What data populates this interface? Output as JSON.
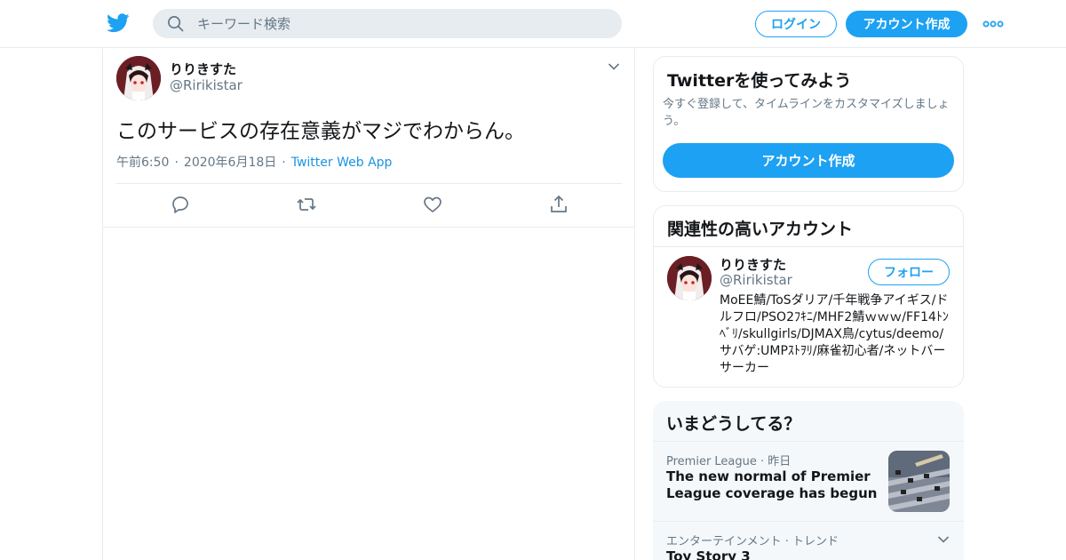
{
  "header": {
    "search_placeholder": "キーワード検索",
    "login_label": "ログイン",
    "signup_label": "アカウント作成"
  },
  "colors": {
    "brand": "#1da1f2",
    "text_secondary": "#657786",
    "border": "#e6ecf0"
  },
  "tweet": {
    "display_name": "りりきすた",
    "handle": "@Ririkistar",
    "text": "このサービスの存在意義がマジでわからん。",
    "time": "午前6:50",
    "date": "2020年6月18日",
    "source": "Twitter Web App",
    "dot": "·"
  },
  "signup_card": {
    "title": "Twitterを使ってみよう",
    "description": "今すぐ登録して、タイムラインをカスタマイズしましょう。",
    "button_label": "アカウント作成"
  },
  "related_card": {
    "title": "関連性の高いアカウント",
    "account": {
      "display_name": "りりきすた",
      "handle": "@Ririkistar",
      "follow_label": "フォロー",
      "bio": "MoEE鯖/ToSダリア/千年戦争アイギス/ドルフロ/PSO2ﾌｷﾆ/MHF2鯖ｗｗｗ/FF14ﾄﾝﾍﾞﾘ/skullgirls/DJMAX鳥/cytus/deemo/サバゲ:UMPｽﾄｦﾘ/麻雀初心者/ネットバーサーカー"
    }
  },
  "trends_card": {
    "title": "いまどうしてる？",
    "items": [
      {
        "category": "Premier League",
        "time": "昨日",
        "title": "The new normal of Premier League coverage has begun"
      },
      {
        "category": "エンターテインメント · トレンド",
        "title": "Toy Story 3"
      }
    ]
  }
}
